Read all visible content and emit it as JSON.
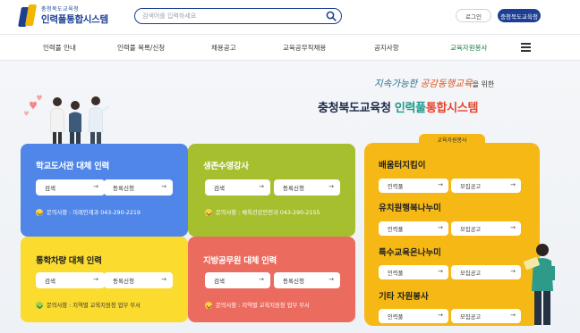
{
  "header": {
    "logo_sub": "충청북도교육청",
    "logo_title": "인력풀통합시스템",
    "search_placeholder": "검색어를 입력하세요",
    "login_label": "로그인",
    "site_label": "충청북도교육청"
  },
  "nav": {
    "items": [
      {
        "label": "인력풀 안내"
      },
      {
        "label": "인력풀 목록/신청"
      },
      {
        "label": "채용공고"
      },
      {
        "label": "교육공무직채용"
      },
      {
        "label": "공지사항"
      },
      {
        "label": "교육자원봉사"
      }
    ]
  },
  "hero": {
    "slogan_a": "지속가능한 ",
    "slogan_b": "공감동행교육",
    "slogan_c": "을 위한",
    "main_a": "충청북도교육청 ",
    "main_b": "인력풀",
    "main_c": "통합시스템"
  },
  "cards": [
    {
      "title": "학교도서관 대체 인력",
      "btn1": "검색",
      "btn2": "등록신청",
      "contact": "문의사항 : 미래인재과 043-290-2219"
    },
    {
      "title": "생존수영강사",
      "btn1": "검색",
      "btn2": "등록신청",
      "contact": "문의사항 : 체육건강안전과 043-290-2155"
    },
    {
      "title": "통학차량 대체 인력",
      "btn1": "검색",
      "btn2": "등록신청",
      "contact": "문의사항 : 지역별 교육지원청 업무 부서"
    },
    {
      "title": "지방공무원 대체 인력",
      "btn1": "검색",
      "btn2": "등록신청",
      "contact": "문의사항 : 지역별 교육지원청 업무 부서"
    }
  ],
  "volunteer": {
    "tag": "교육자원봉사",
    "sections": [
      {
        "title": "배움터지킴이",
        "btn1": "인력풀",
        "btn2": "모집공고"
      },
      {
        "title": "유치원행복나누미",
        "btn1": "인력풀",
        "btn2": "모집공고"
      },
      {
        "title": "특수교육온나누미",
        "btn1": "인력풀",
        "btn2": "모집공고"
      },
      {
        "title": "기타 자원봉사",
        "btn1": "인력풀",
        "btn2": "모집공고"
      }
    ]
  },
  "colors": {
    "brand": "#1c3f94",
    "card_blue": "#4f86e8",
    "card_green": "#a5bf2f",
    "card_yellow": "#fadb2e",
    "card_red": "#ec6b5f",
    "card_orange": "#f6b814"
  }
}
